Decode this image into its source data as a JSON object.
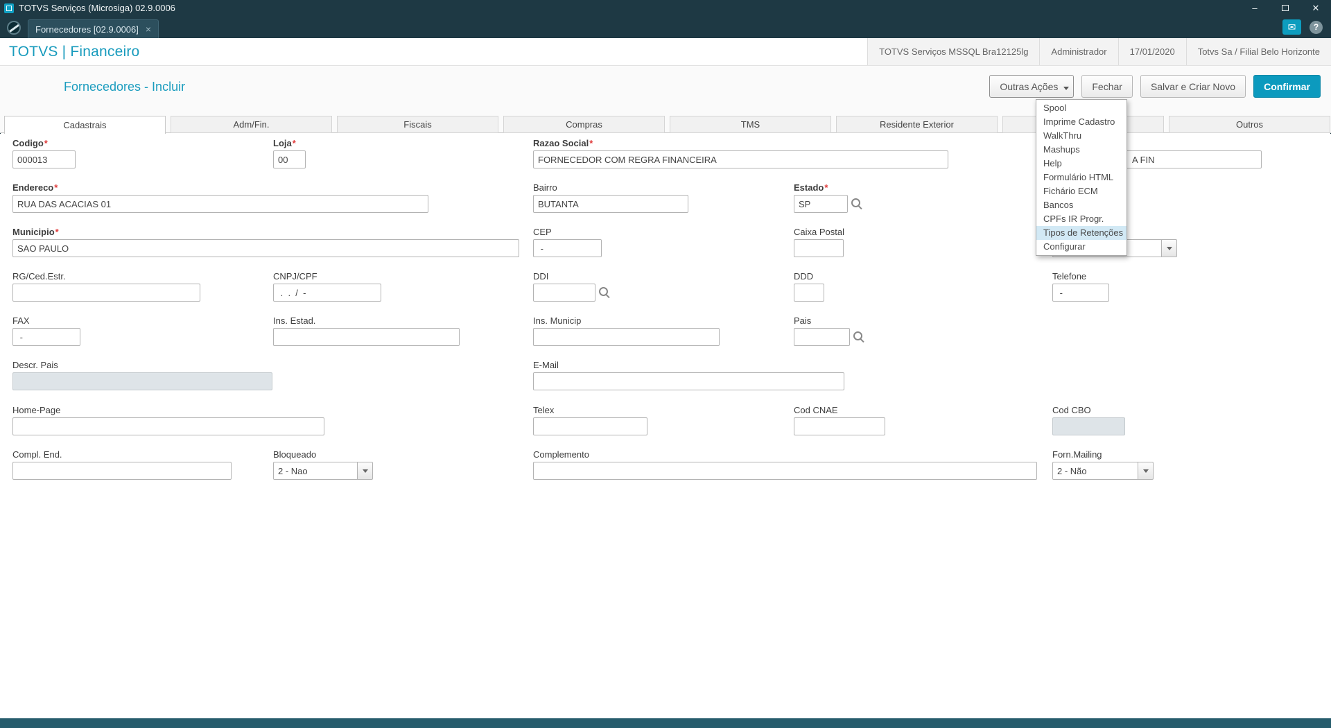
{
  "colors": {
    "accent": "#0c9abe",
    "titlebar": "#1e3944",
    "footer": "#265c6c",
    "menu_highlight": "#d2e9f5",
    "required_marker": "#e03c3c",
    "disabled_field": "#dee4e8"
  },
  "titlebar": {
    "title": "TOTVS Serviços (Microsiga) 02.9.0006",
    "minimize_icon": "–",
    "close_icon": "✕"
  },
  "tabbar": {
    "doc_tab_label": "Fornecedores [02.9.0006]",
    "tab_close_icon": "×",
    "mail_icon": "✉",
    "help_icon": "?"
  },
  "header": {
    "brand": "TOTVS | Financeiro",
    "environment": "TOTVS Serviços MSSQL Bra12125lg",
    "user": "Administrador",
    "date": "17/01/2020",
    "company": "Totvs Sa / Filial Belo Horizonte"
  },
  "page": {
    "title": "Fornecedores - Incluir",
    "actions": {
      "more": "Outras Ações",
      "close": "Fechar",
      "save_new": "Salvar e Criar Novo",
      "confirm": "Confirmar"
    }
  },
  "menu": {
    "items": [
      {
        "label": "Spool",
        "highlighted": false
      },
      {
        "label": "Imprime Cadastro",
        "highlighted": false
      },
      {
        "label": "WalkThru",
        "highlighted": false
      },
      {
        "label": "Mashups",
        "highlighted": false
      },
      {
        "label": "Help",
        "highlighted": false
      },
      {
        "label": "Formulário HTML",
        "highlighted": false
      },
      {
        "label": "Fichário ECM",
        "highlighted": false
      },
      {
        "label": "Bancos",
        "highlighted": false
      },
      {
        "label": "CPFs IR Progr.",
        "highlighted": false
      },
      {
        "label": "Tipos de Retenções",
        "highlighted": true
      },
      {
        "label": "Configurar",
        "highlighted": false
      }
    ]
  },
  "tabs": {
    "items": [
      {
        "label": "Cadastrais",
        "active": true
      },
      {
        "label": "Adm/Fin.",
        "active": false
      },
      {
        "label": "Fiscais",
        "active": false
      },
      {
        "label": "Compras",
        "active": false
      },
      {
        "label": "TMS",
        "active": false
      },
      {
        "label": "Residente Exterior",
        "active": false
      },
      {
        "label": "",
        "active": false
      },
      {
        "label": "Outros",
        "active": false
      }
    ]
  },
  "misc": {
    "required_marker": "*"
  },
  "form": {
    "codigo": {
      "label": "Codigo",
      "value": "000013",
      "required": true
    },
    "loja": {
      "label": "Loja",
      "value": "00",
      "required": true
    },
    "razao_social": {
      "label": "Razao Social",
      "value": "FORNECEDOR COM REGRA FINANCEIRA",
      "required": true
    },
    "obscured1": {
      "label": "",
      "value": "A FIN"
    },
    "endereco": {
      "label": "Endereco",
      "value": "RUA DAS ACACIAS 01",
      "required": true
    },
    "bairro": {
      "label": "Bairro",
      "value": "BUTANTA"
    },
    "estado": {
      "label": "Estado",
      "value": "SP",
      "required": true
    },
    "municipio": {
      "label": "Municipio",
      "value": "SAO PAULO",
      "required": true
    },
    "cep": {
      "label": "CEP",
      "value": " - "
    },
    "caixa_postal": {
      "label": "Caixa Postal",
      "value": ""
    },
    "obscured_combo": {
      "label": "",
      "value": ""
    },
    "rg": {
      "label": "RG/Ced.Estr.",
      "value": ""
    },
    "cnpj": {
      "label": "CNPJ/CPF",
      "value": " .  .  /  -"
    },
    "ddi": {
      "label": "DDI",
      "value": ""
    },
    "ddd": {
      "label": "DDD",
      "value": ""
    },
    "telefone": {
      "label": "Telefone",
      "value": " - "
    },
    "fax": {
      "label": "FAX",
      "value": " - "
    },
    "ins_estad": {
      "label": "Ins. Estad.",
      "value": ""
    },
    "ins_municip": {
      "label": "Ins. Municip",
      "value": ""
    },
    "pais": {
      "label": "Pais",
      "value": ""
    },
    "descr_pais": {
      "label": "Descr. Pais",
      "value": ""
    },
    "email": {
      "label": "E-Mail",
      "value": ""
    },
    "home_page": {
      "label": "Home-Page",
      "value": ""
    },
    "telex": {
      "label": "Telex",
      "value": ""
    },
    "cod_cnae": {
      "label": "Cod CNAE",
      "value": ""
    },
    "cod_cbo": {
      "label": "Cod CBO",
      "value": ""
    },
    "compl_end": {
      "label": "Compl. End.",
      "value": ""
    },
    "bloqueado": {
      "label": "Bloqueado",
      "value": "2 - Nao"
    },
    "complemento": {
      "label": "Complemento",
      "value": ""
    },
    "forn_mailing": {
      "label": "Forn.Mailing",
      "value": "2 - Não"
    }
  }
}
